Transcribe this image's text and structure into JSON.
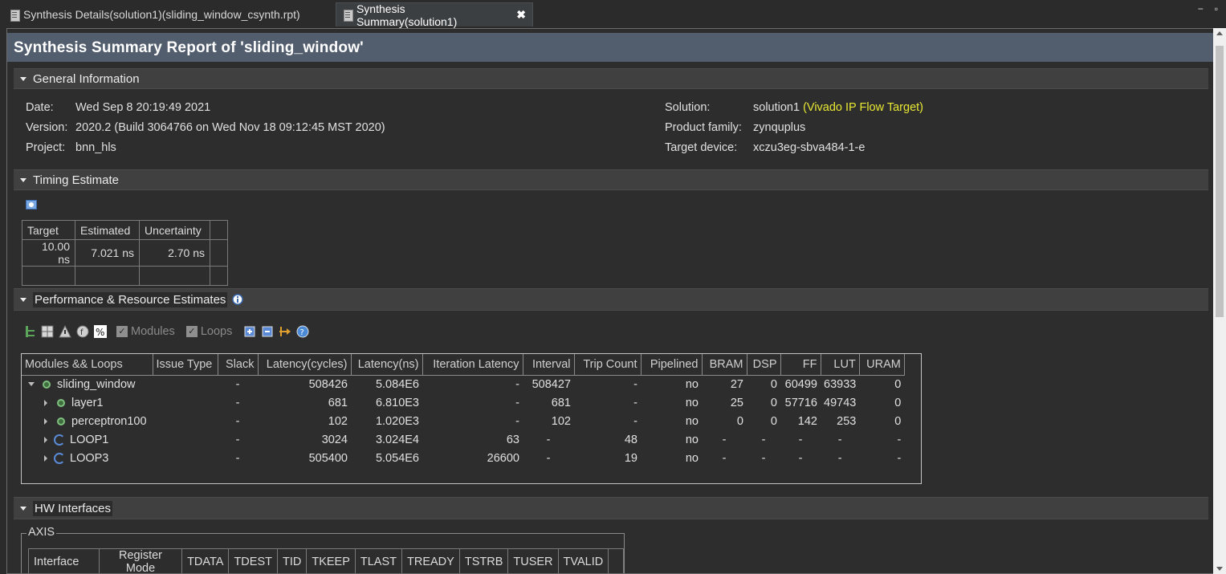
{
  "tabs": [
    {
      "label": "Synthesis Details(solution1)(sliding_window_csynth.rpt)"
    },
    {
      "label": "Synthesis Summary(solution1)",
      "close": "✖"
    }
  ],
  "window_controls": {
    "minimize": "−",
    "maximize": "▫"
  },
  "report_title": "Synthesis Summary Report of 'sliding_window'",
  "general": {
    "header": "General Information",
    "date_label": "Date:",
    "date": "Wed Sep 8 20:19:49 2021",
    "version_label": "Version:",
    "version": "2020.2 (Build 3064766 on Wed Nov 18 09:12:45 MST 2020)",
    "project_label": "Project:",
    "project": "bnn_hls",
    "solution_label": "Solution:",
    "solution": "solution1",
    "solution_target": "(Vivado IP Flow Target)",
    "family_label": "Product family:",
    "family": "zynquplus",
    "device_label": "Target device:",
    "device": "xczu3eg-sbva484-1-e"
  },
  "timing": {
    "header": "Timing Estimate",
    "columns": [
      "Target",
      "Estimated",
      "Uncertainty",
      ""
    ],
    "row": [
      "10.00 ns",
      "7.021 ns",
      "2.70 ns",
      ""
    ]
  },
  "perf": {
    "header": "Performance & Resource Estimates",
    "modules_label": "Modules",
    "loops_label": "Loops",
    "columns": [
      "Modules && Loops",
      "Issue Type",
      "Slack",
      "Latency(cycles)",
      "Latency(ns)",
      "Iteration Latency",
      "Interval",
      "Trip Count",
      "Pipelined",
      "BRAM",
      "DSP",
      "FF",
      "LUT",
      "URAM"
    ],
    "rows": [
      {
        "name": "sliding_window",
        "issue": "",
        "slack": "-",
        "lat_cycles": "508426",
        "lat_ns": "5.084E6",
        "iter_lat": "-",
        "interval": "508427",
        "trip": "-",
        "pipelined": "no",
        "bram": "27",
        "dsp": "0",
        "ff": "60499",
        "lut": "63933",
        "uram": "0"
      },
      {
        "name": "layer1",
        "issue": "",
        "slack": "-",
        "lat_cycles": "681",
        "lat_ns": "6.810E3",
        "iter_lat": "-",
        "interval": "681",
        "trip": "-",
        "pipelined": "no",
        "bram": "25",
        "dsp": "0",
        "ff": "57716",
        "lut": "49743",
        "uram": "0"
      },
      {
        "name": "perceptron100",
        "issue": "",
        "slack": "-",
        "lat_cycles": "102",
        "lat_ns": "1.020E3",
        "iter_lat": "-",
        "interval": "102",
        "trip": "-",
        "pipelined": "no",
        "bram": "0",
        "dsp": "0",
        "ff": "142",
        "lut": "253",
        "uram": "0"
      },
      {
        "name": "LOOP1",
        "issue": "",
        "slack": "-",
        "lat_cycles": "3024",
        "lat_ns": "3.024E4",
        "iter_lat": "63",
        "interval": "-",
        "trip": "48",
        "pipelined": "no",
        "bram": "-",
        "dsp": "-",
        "ff": "-",
        "lut": "-",
        "uram": "-"
      },
      {
        "name": "LOOP3",
        "issue": "",
        "slack": "-",
        "lat_cycles": "505400",
        "lat_ns": "5.054E6",
        "iter_lat": "26600",
        "interval": "-",
        "trip": "19",
        "pipelined": "no",
        "bram": "-",
        "dsp": "-",
        "ff": "-",
        "lut": "-",
        "uram": "-"
      }
    ]
  },
  "hw": {
    "header": "HW Interfaces",
    "axis_label": "AXIS",
    "columns": [
      "Interface",
      "Register Mode",
      "TDATA",
      "TDEST",
      "TID",
      "TKEEP",
      "TLAST",
      "TREADY",
      "TSTRB",
      "TUSER",
      "TVALID",
      ""
    ]
  },
  "colors": {
    "title_bar": "#525e6e",
    "section": "#404040",
    "accent_yellow": "#e8e833",
    "module_green": "#7fc07f",
    "loop_blue": "#5a8ad6"
  }
}
